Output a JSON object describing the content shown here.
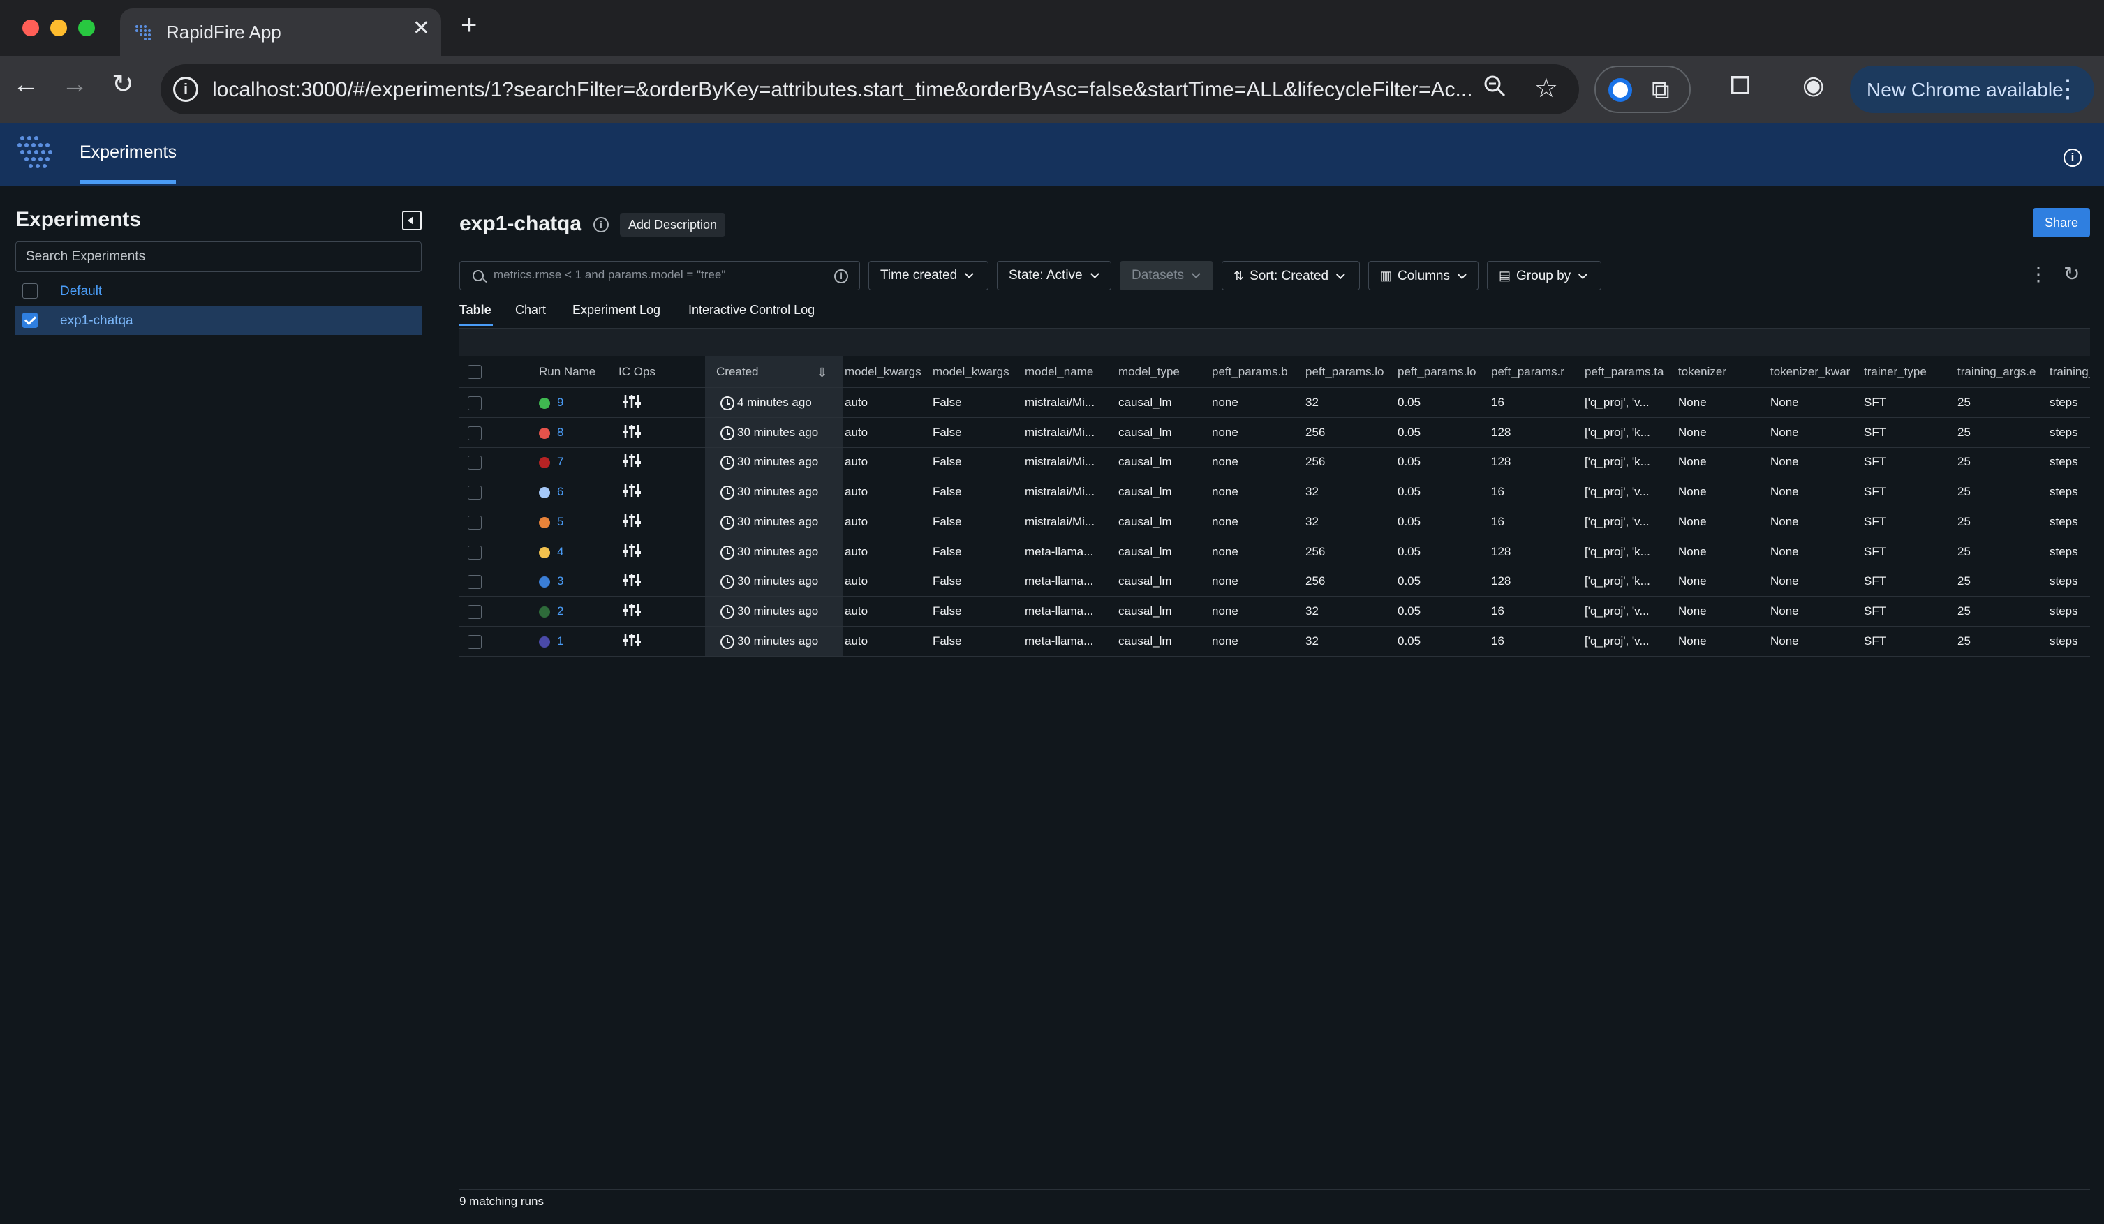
{
  "browser": {
    "tab_title": "RapidFire App",
    "tab_close": "✕",
    "new_tab": "+",
    "url": "localhost:3000/#/experiments/1?searchFilter=&orderByKey=attributes.start_time&orderByAsc=false&startTime=ALL&lifecycleFilter=Ac...",
    "update_label": "New Chrome available"
  },
  "app": {
    "nav_item": "Experiments"
  },
  "sidebar": {
    "title": "Experiments",
    "search_placeholder": "Search Experiments",
    "experiments": [
      {
        "name": "Default",
        "checked": false
      },
      {
        "name": "exp1-chatqa",
        "checked": true
      }
    ]
  },
  "main": {
    "title": "exp1-chatqa",
    "add_description": "Add Description",
    "share": "Share",
    "search_placeholder": "metrics.rmse < 1 and params.model = \"tree\"",
    "filters": {
      "time": "Time created",
      "state": "State: Active",
      "datasets": "Datasets",
      "sort": "Sort: Created",
      "columns": "Columns",
      "group": "Group by"
    },
    "tabs": [
      "Table",
      "Chart",
      "Experiment Log",
      "Interactive Control Log"
    ]
  },
  "table": {
    "headers": {
      "run_name": "Run Name",
      "ic_ops": "IC Ops",
      "created": "Created",
      "cols": [
        "model_kwargs",
        "model_kwargs",
        "model_name",
        "model_type",
        "peft_params.b",
        "peft_params.lo",
        "peft_params.lo",
        "peft_params.r",
        "peft_params.ta",
        "tokenizer",
        "tokenizer_kwar",
        "trainer_type",
        "training_args.e",
        "training_"
      ]
    },
    "rows": [
      {
        "run": "9",
        "color": "#3fb950",
        "created": "4 minutes ago",
        "cells": [
          "auto",
          "False",
          "mistralai/Mi...",
          "causal_lm",
          "none",
          "32",
          "0.05",
          "16",
          "['q_proj', 'v...",
          "None",
          "None",
          "SFT",
          "25",
          "steps"
        ]
      },
      {
        "run": "8",
        "color": "#e5534b",
        "created": "30 minutes ago",
        "cells": [
          "auto",
          "False",
          "mistralai/Mi...",
          "causal_lm",
          "none",
          "256",
          "0.05",
          "128",
          "['q_proj', 'k...",
          "None",
          "None",
          "SFT",
          "25",
          "steps"
        ]
      },
      {
        "run": "7",
        "color": "#b62324",
        "created": "30 minutes ago",
        "cells": [
          "auto",
          "False",
          "mistralai/Mi...",
          "causal_lm",
          "none",
          "256",
          "0.05",
          "128",
          "['q_proj', 'k...",
          "None",
          "None",
          "SFT",
          "25",
          "steps"
        ]
      },
      {
        "run": "6",
        "color": "#a5c8f7",
        "created": "30 minutes ago",
        "cells": [
          "auto",
          "False",
          "mistralai/Mi...",
          "causal_lm",
          "none",
          "32",
          "0.05",
          "16",
          "['q_proj', 'v...",
          "None",
          "None",
          "SFT",
          "25",
          "steps"
        ]
      },
      {
        "run": "5",
        "color": "#e8833a",
        "created": "30 minutes ago",
        "cells": [
          "auto",
          "False",
          "mistralai/Mi...",
          "causal_lm",
          "none",
          "32",
          "0.05",
          "16",
          "['q_proj', 'v...",
          "None",
          "None",
          "SFT",
          "25",
          "steps"
        ]
      },
      {
        "run": "4",
        "color": "#f2c14e",
        "created": "30 minutes ago",
        "cells": [
          "auto",
          "False",
          "meta-llama...",
          "causal_lm",
          "none",
          "256",
          "0.05",
          "128",
          "['q_proj', 'k...",
          "None",
          "None",
          "SFT",
          "25",
          "steps"
        ]
      },
      {
        "run": "3",
        "color": "#3b7ed6",
        "created": "30 minutes ago",
        "cells": [
          "auto",
          "False",
          "meta-llama...",
          "causal_lm",
          "none",
          "256",
          "0.05",
          "128",
          "['q_proj', 'k...",
          "None",
          "None",
          "SFT",
          "25",
          "steps"
        ]
      },
      {
        "run": "2",
        "color": "#2e6b3a",
        "created": "30 minutes ago",
        "cells": [
          "auto",
          "False",
          "meta-llama...",
          "causal_lm",
          "none",
          "32",
          "0.05",
          "16",
          "['q_proj', 'v...",
          "None",
          "None",
          "SFT",
          "25",
          "steps"
        ]
      },
      {
        "run": "1",
        "color": "#4a4aa8",
        "created": "30 minutes ago",
        "cells": [
          "auto",
          "False",
          "meta-llama...",
          "causal_lm",
          "none",
          "32",
          "0.05",
          "16",
          "['q_proj', 'v...",
          "None",
          "None",
          "SFT",
          "25",
          "steps"
        ]
      }
    ]
  },
  "footer": {
    "count": "9 matching runs"
  },
  "colors": {
    "app_header": "#15325c",
    "accent": "#2f7fe0",
    "link": "#4a9cf6",
    "background": "#11171c"
  }
}
